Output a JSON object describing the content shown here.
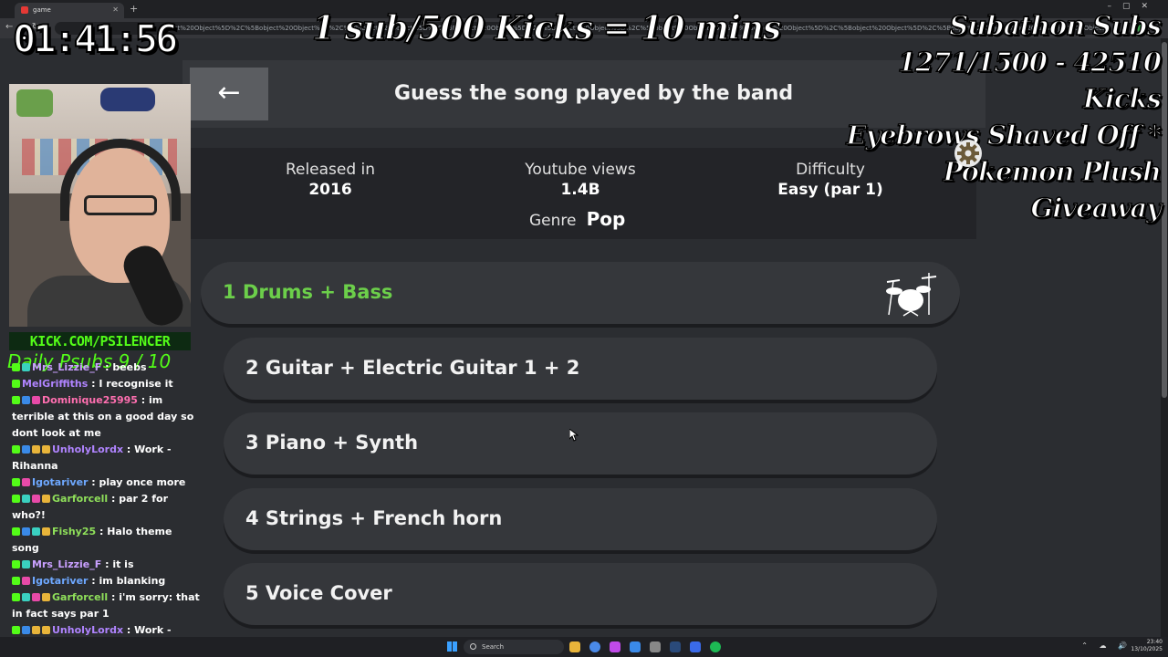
{
  "browser": {
    "tab_title": "game",
    "tab_close": "✕",
    "new_tab": "+",
    "nav_glyphs": "←→↻",
    "url_text": "bject%20Object%5D%2C%5Bobject%20Object%5D%2C%5Bobject%20Object%5D%2C%5Bobject%20Object%5D%2C%5Bobject%20Object%5D%2C%5Bobject%20Object%5D%2C%5Bobject%20Object%5D%2C%5Bobject%20Object%5D%2C%5Bobject%20Object%5D%2C%5Bobject%20Object%5D%2C%5Bobject%20Object%5D",
    "window_controls": "–▢✕"
  },
  "game": {
    "back_icon": "←",
    "title": "Guess the song played by the band",
    "info": {
      "released_label": "Released in",
      "released_value": "2016",
      "views_label": "Youtube views",
      "views_value": "1.4B",
      "difficulty_label": "Difficulty",
      "difficulty_value": "Easy (par 1)",
      "genre_label": "Genre",
      "genre_value": "Pop"
    },
    "tracks": [
      {
        "label": "1  Drums + Bass",
        "active": true,
        "icon": "drum-kit-icon"
      },
      {
        "label": "2  Guitar + Electric Guitar 1 + 2",
        "active": false
      },
      {
        "label": "3  Piano + Synth",
        "active": false
      },
      {
        "label": "4  Strings + French horn",
        "active": false
      },
      {
        "label": "5  Voice Cover",
        "active": false
      }
    ],
    "active_color": "#6ccf4a"
  },
  "overlay": {
    "timer": "01:41:56",
    "banner": "1 sub/500 Kicks = 10 mins",
    "subathon_lines": [
      "Subathon Subs",
      "1271/1500 - 42510 Kicks",
      "Eyebrows Shaved Off *",
      "Pokemon Plush Giveaway"
    ],
    "kick_url": "KICK.COM/PSILENCER",
    "daily_psubs": "Daily Psubs 9 / 10",
    "kick_green": "#53fc18"
  },
  "chat": [
    {
      "badges": [
        "b-kick",
        "b-teal"
      ],
      "user": "Mrs_Lizzie_F",
      "color": "#c9a0ff",
      "text": "beebs"
    },
    {
      "badges": [
        "b-kick"
      ],
      "user": "MelGriffiths",
      "color": "#b084ff",
      "text": "I recognise it"
    },
    {
      "badges": [
        "b-kick",
        "b-blue",
        "b-pink"
      ],
      "user": "Dominique25995",
      "color": "#ff6fb0",
      "text": "im terrible at this on a good day so dont look at me"
    },
    {
      "badges": [
        "b-kick",
        "b-blue",
        "b-gold",
        "b-gold"
      ],
      "user": "UnholyLordx",
      "color": "#b084ff",
      "text": "Work - Rihanna"
    },
    {
      "badges": [
        "b-kick",
        "b-pink"
      ],
      "user": "Igotariver",
      "color": "#6ea8ff",
      "text": "play once more"
    },
    {
      "badges": [
        "b-kick",
        "b-teal",
        "b-pink",
        "b-gold"
      ],
      "user": "Garforcell",
      "color": "#8fe05a",
      "text": "par 2 for who?!"
    },
    {
      "badges": [
        "b-kick",
        "b-blue",
        "b-teal",
        "b-gold"
      ],
      "user": "Fishy25",
      "color": "#8fe05a",
      "text": "Halo theme song"
    },
    {
      "badges": [
        "b-kick",
        "b-teal"
      ],
      "user": "Mrs_Lizzie_F",
      "color": "#c9a0ff",
      "text": "it is"
    },
    {
      "badges": [
        "b-kick",
        "b-pink"
      ],
      "user": "Igotariver",
      "color": "#6ea8ff",
      "text": "im blanking"
    },
    {
      "badges": [
        "b-kick",
        "b-teal",
        "b-pink",
        "b-gold"
      ],
      "user": "Garforcell",
      "color": "#8fe05a",
      "text": "i'm sorry: that in fact says par 1"
    },
    {
      "badges": [
        "b-kick",
        "b-blue",
        "b-gold",
        "b-gold"
      ],
      "user": "UnholyLordx",
      "color": "#b084ff",
      "text": "Work - Rihanna is my shout"
    }
  ],
  "taskbar": {
    "search_placeholder": "Search",
    "tray": "⌃ ☁ 🔊",
    "clock_time": "23:40",
    "clock_date": "13/10/2025"
  }
}
